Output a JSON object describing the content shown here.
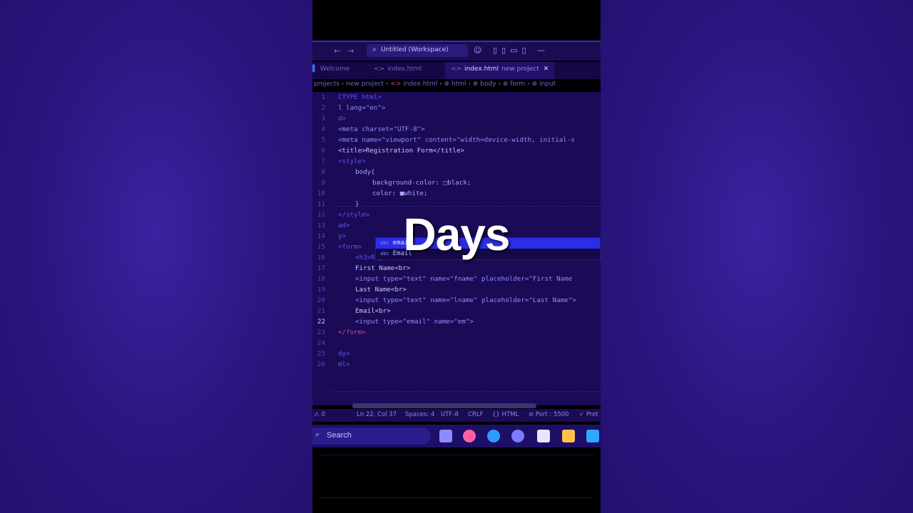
{
  "overlay": {
    "caption": "Days"
  },
  "window": {
    "search_label": "Untitled (Workspace)"
  },
  "tabs": [
    {
      "label": "Welcome"
    },
    {
      "label": "index.html"
    },
    {
      "label": "index.html",
      "sub": "new project",
      "active": true
    }
  ],
  "breadcrumb": [
    "projects",
    "new project",
    "index.html",
    "html",
    "body",
    "form",
    "input"
  ],
  "editor": {
    "current_line": 22,
    "lines": [
      {
        "n": "1",
        "text": "CTYPE html>"
      },
      {
        "n": "2",
        "text": "l lang=\"en\">"
      },
      {
        "n": "3",
        "text": "d>"
      },
      {
        "n": "4",
        "text": "<meta charset=\"UTF-8\">"
      },
      {
        "n": "5",
        "text": "<meta name=\"viewport\" content=\"width=device-width, initial-s"
      },
      {
        "n": "6",
        "text": "<title>Registration Form</title>"
      },
      {
        "n": "7",
        "text": "<style>"
      },
      {
        "n": "8",
        "text": "body{"
      },
      {
        "n": "9",
        "text": "background-color: □black;"
      },
      {
        "n": "10",
        "text": "color: ■white;"
      },
      {
        "n": "11",
        "text": "}"
      },
      {
        "n": "12",
        "text": "</style>"
      },
      {
        "n": "13",
        "text": "ad>"
      },
      {
        "n": "14",
        "text": "y>"
      },
      {
        "n": "15",
        "text": "<form>"
      },
      {
        "n": "16",
        "text": "<h3>Registration form</h3><br>"
      },
      {
        "n": "17",
        "text": "First Name<br>"
      },
      {
        "n": "18",
        "text": "<input type=\"text\" name=\"fname\" placeholder=\"First Name"
      },
      {
        "n": "19",
        "text": "Last Name<br>"
      },
      {
        "n": "20",
        "text": "<input type=\"text\" name=\"lname\" placeholder=\"Last Name\">"
      },
      {
        "n": "21",
        "text": "Email<br>"
      },
      {
        "n": "22",
        "text": "<input type=\"email\" name=\"em\">"
      },
      {
        "n": "23",
        "text": "</form>"
      },
      {
        "n": "24",
        "text": ""
      },
      {
        "n": "25",
        "text": "dy>"
      },
      {
        "n": "26",
        "text": "ml>"
      }
    ]
  },
  "autocomplete": {
    "items": [
      {
        "label": "email",
        "selected": true
      },
      {
        "label": "Email",
        "selected": false
      }
    ]
  },
  "statusbar": {
    "problems": "0",
    "position": "Ln 22, Col 37",
    "spaces": "Spaces: 4",
    "encoding": "UTF-8",
    "eol": "CRLF",
    "language": "HTML",
    "port": "Port : 5500",
    "extra": "Pret"
  },
  "taskbar": {
    "search_label": "Search",
    "apps": [
      "files",
      "copilot",
      "edge",
      "teams",
      "store",
      "explorer",
      "mail"
    ],
    "app_colors": [
      "#8c8cff",
      "#ff5fa0",
      "#2f9bff",
      "#7b7bff",
      "#e6e6ff",
      "#ffc24a",
      "#2ea8ff"
    ]
  },
  "colors": {
    "background": "#2a1478",
    "editor_bg": "#1b0a55",
    "selection": "#2a2ee8"
  }
}
